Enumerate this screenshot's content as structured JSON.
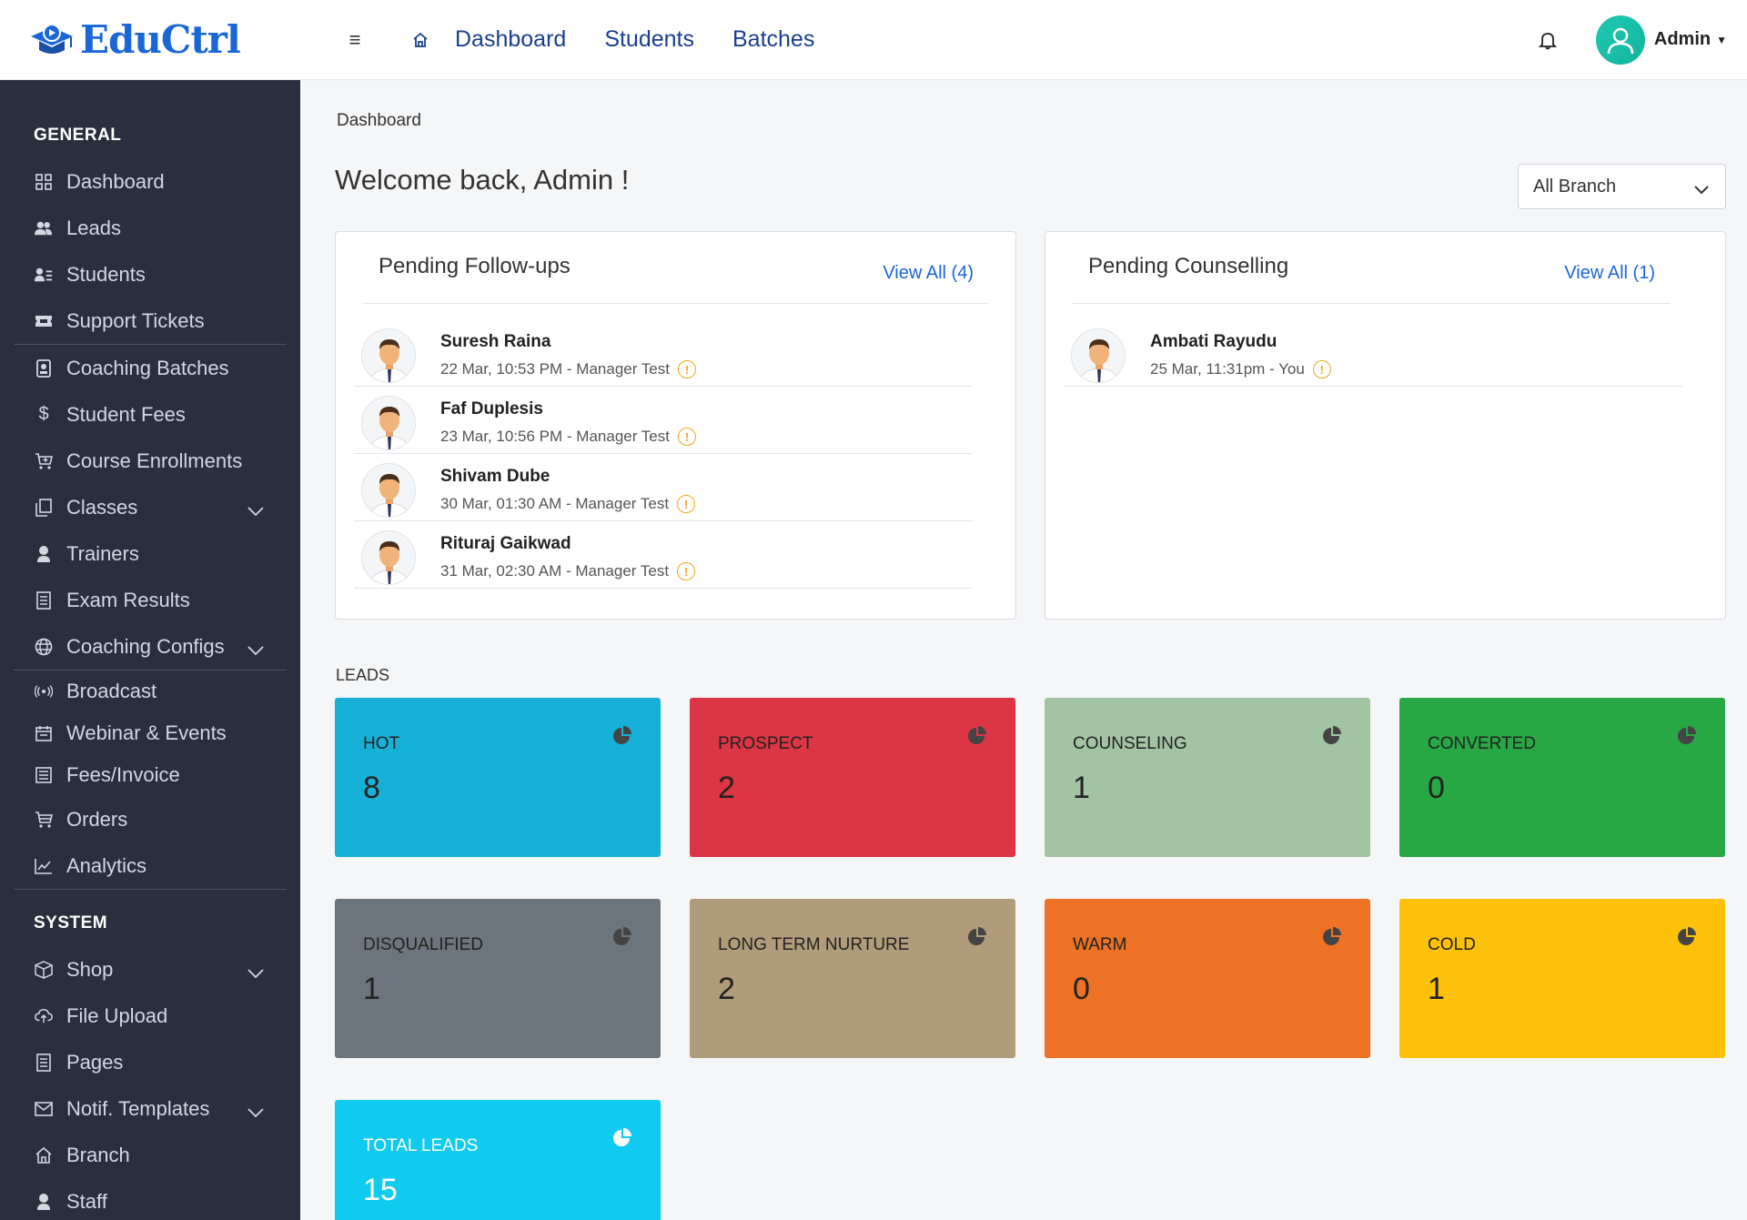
{
  "app": {
    "logo_text": "EduCtrl"
  },
  "topnav": {
    "items": [
      "Dashboard",
      "Students",
      "Batches"
    ],
    "user": "Admin"
  },
  "sidebar": {
    "general_title": "GENERAL",
    "system_title": "SYSTEM",
    "group1": [
      "Dashboard",
      "Leads",
      "Students",
      "Support Tickets"
    ],
    "group2": [
      "Coaching Batches",
      "Student Fees",
      "Course Enrollments",
      "Classes",
      "Trainers",
      "Exam Results",
      "Coaching Configs"
    ],
    "group3": [
      "Broadcast",
      "Webinar & Events",
      "Fees/Invoice",
      "Orders",
      "Analytics"
    ],
    "group4": [
      "Shop",
      "File Upload",
      "Pages",
      "Notif. Templates",
      "Branch",
      "Staff"
    ]
  },
  "main": {
    "breadcrumb": "Dashboard",
    "welcome": "Welcome back, Admin !",
    "branch_select": "All Branch"
  },
  "followups": {
    "title": "Pending Follow-ups",
    "view_all": "View All (4)",
    "items": [
      {
        "name": "Suresh Raina",
        "meta": "22 Mar, 10:53 PM - Manager Test"
      },
      {
        "name": "Faf Duplesis",
        "meta": "23 Mar, 10:56 PM - Manager Test"
      },
      {
        "name": "Shivam Dube",
        "meta": "30 Mar, 01:30 AM - Manager Test"
      },
      {
        "name": "Rituraj Gaikwad",
        "meta": "31 Mar, 02:30 AM - Manager Test"
      }
    ]
  },
  "counselling": {
    "title": "Pending Counselling",
    "view_all": "View All (1)",
    "items": [
      {
        "name": "Ambati Rayudu",
        "meta": "25 Mar, 11:31pm - You"
      }
    ]
  },
  "leads": {
    "label": "LEADS",
    "tiles": [
      {
        "label": "HOT",
        "value": "8",
        "color": "#17b0d6"
      },
      {
        "label": "PROSPECT",
        "value": "2",
        "color": "#dc3545"
      },
      {
        "label": "COUNSELING",
        "value": "1",
        "color": "#a3c4a2"
      },
      {
        "label": "CONVERTED",
        "value": "0",
        "color": "#28a745"
      },
      {
        "label": "DISQUALIFIED",
        "value": "1",
        "color": "#6c757d"
      },
      {
        "label": "LONG TERM NURTURE",
        "value": "2",
        "color": "#b09b7a"
      },
      {
        "label": "WARM",
        "value": "0",
        "color": "#ee7226"
      },
      {
        "label": "COLD",
        "value": "1",
        "color": "#fdc10a"
      },
      {
        "label": "TOTAL LEADS",
        "value": "15",
        "color": "#11caf0"
      }
    ]
  }
}
